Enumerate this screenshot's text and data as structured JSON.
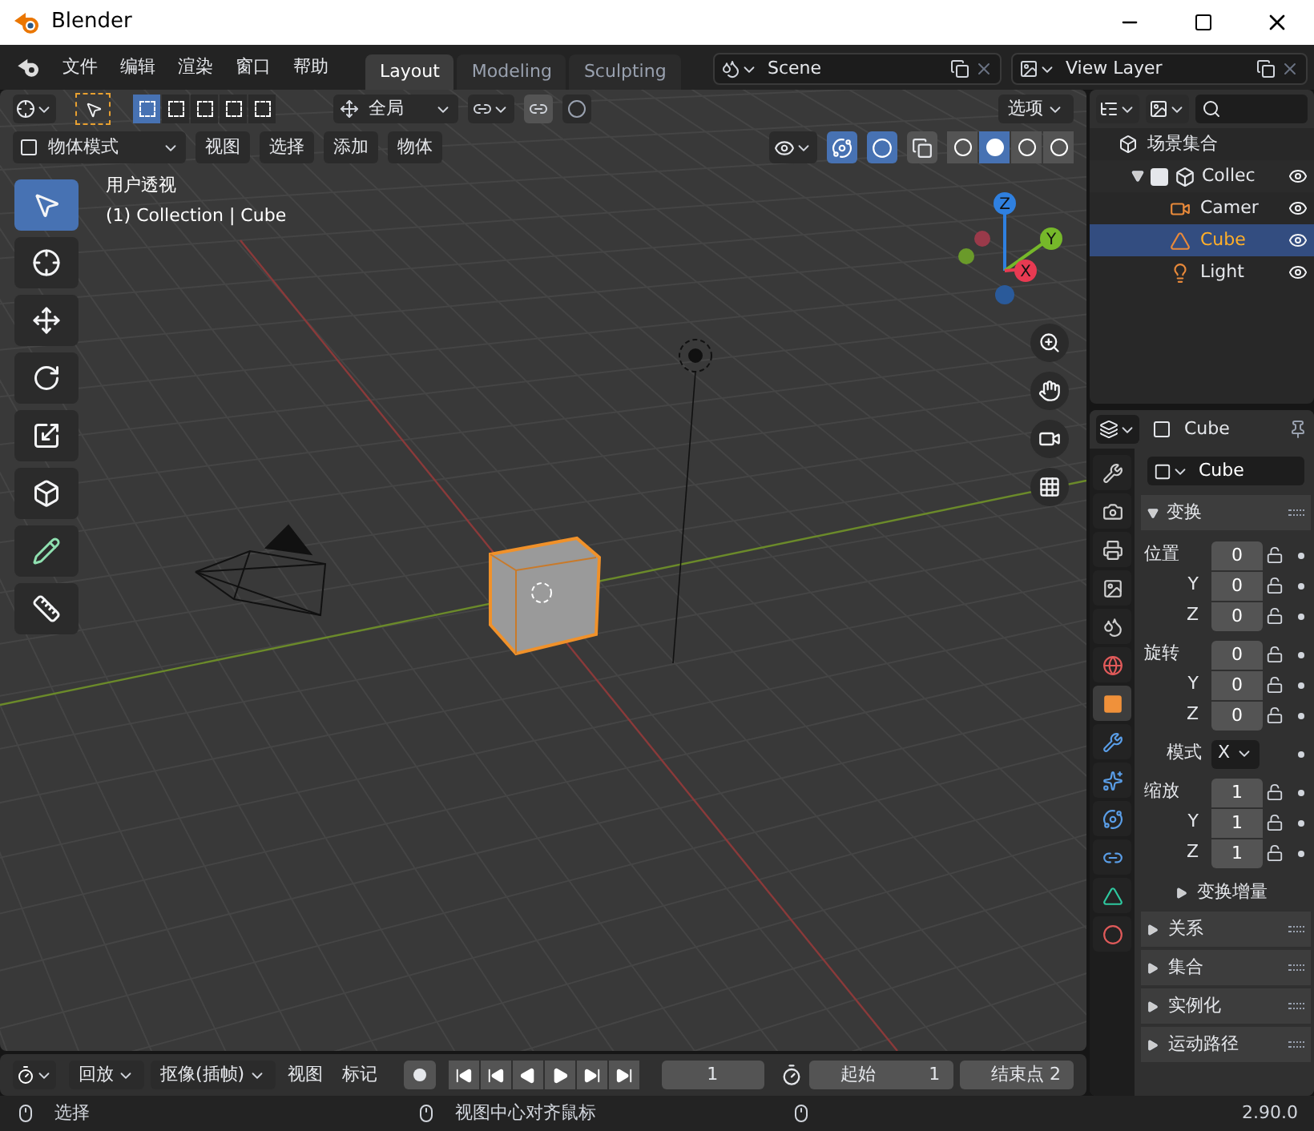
{
  "window": {
    "title": "Blender"
  },
  "menu": [
    "文件",
    "编辑",
    "渲染",
    "窗口",
    "帮助"
  ],
  "workspace_tabs": [
    {
      "label": "Layout",
      "selected": true
    },
    {
      "label": "Modeling",
      "selected": false
    },
    {
      "label": "Sculpting",
      "selected": false
    }
  ],
  "scene": {
    "value": "Scene"
  },
  "view_layer": {
    "value": "View Layer"
  },
  "viewport": {
    "select_modes": [
      {
        "selected": true
      },
      {
        "selected": false
      },
      {
        "selected": false
      },
      {
        "selected": false
      },
      {
        "selected": false
      }
    ],
    "orientation": "全局",
    "snap": {
      "on": false
    },
    "options": "选项",
    "mode": "物体模式",
    "menus": [
      "视图",
      "选择",
      "添加",
      "物体"
    ],
    "overlays": {
      "on": true
    },
    "xray": {
      "on": false
    },
    "gizmos": {
      "on": true
    },
    "shading": [
      {
        "selected": false
      },
      {
        "selected": true
      },
      {
        "selected": false
      },
      {
        "selected": false
      }
    ],
    "view_name": "用户透视",
    "object_info": "(1) Collection | Cube",
    "tools": [
      {
        "selected": true
      },
      {
        "selected": false
      },
      {
        "selected": false
      },
      {
        "selected": false
      },
      {
        "selected": false
      },
      {
        "selected": false
      },
      {
        "selected": false
      },
      {
        "selected": false
      }
    ],
    "gizmo_axes": [
      {
        "label": "Z",
        "color": "#2f80e0"
      },
      {
        "label": "Y",
        "color": "#76b82a"
      },
      {
        "label": "X",
        "color": "#e83a52"
      }
    ]
  },
  "outliner": {
    "root": "场景集合",
    "items": [
      {
        "label": "Collec",
        "checked": true,
        "expanded": true,
        "selected": false,
        "children": [
          {
            "kind": "camera",
            "label": "Camer",
            "selected": false
          },
          {
            "kind": "mesh",
            "label": "Cube",
            "selected": true
          },
          {
            "kind": "light",
            "label": "Light",
            "selected": false
          }
        ]
      }
    ]
  },
  "properties": {
    "object": "Cube",
    "name_field": "Cube",
    "tabs": [
      {
        "kind": "tool",
        "selected": false
      },
      {
        "kind": "render",
        "selected": false
      },
      {
        "kind": "output",
        "selected": false
      },
      {
        "kind": "view_layer",
        "selected": false
      },
      {
        "kind": "scene",
        "selected": false
      },
      {
        "kind": "world",
        "selected": false
      },
      {
        "kind": "object",
        "selected": true
      },
      {
        "kind": "modifier",
        "selected": false
      },
      {
        "kind": "particles",
        "selected": false
      },
      {
        "kind": "physics",
        "selected": false
      },
      {
        "kind": "constraint",
        "selected": false
      },
      {
        "kind": "mesh",
        "selected": false
      },
      {
        "kind": "material",
        "selected": false
      }
    ],
    "panel": {
      "title": "变换",
      "expanded": true
    },
    "groups": [
      {
        "rows": [
          {
            "label": "位置",
            "value": "0"
          },
          {
            "label": "Y",
            "value": "0"
          },
          {
            "label": "Z",
            "value": "0"
          }
        ]
      },
      {
        "rows": [
          {
            "label": "旋转",
            "value": "0"
          },
          {
            "label": "Y",
            "value": "0"
          },
          {
            "label": "Z",
            "value": "0"
          }
        ]
      },
      {
        "mode": {
          "label": "模式",
          "value": "X"
        }
      },
      {
        "rows": [
          {
            "label": "缩放",
            "value": "1"
          },
          {
            "label": "Y",
            "value": "1"
          },
          {
            "label": "Z",
            "value": "1"
          }
        ]
      }
    ],
    "subpanel": {
      "title": "变换增量",
      "expanded": false
    },
    "panels": [
      {
        "title": "关系",
        "expanded": false
      },
      {
        "title": "集合",
        "expanded": false
      },
      {
        "title": "实例化",
        "expanded": false
      },
      {
        "title": "运动路径",
        "expanded": false
      }
    ]
  },
  "timeline": {
    "playback": "回放",
    "keying": "抠像(插帧)",
    "menus": [
      "视图",
      "标记"
    ],
    "auto_key": {
      "on": false
    },
    "current_frame": "1",
    "start_label": "起始",
    "start": "1",
    "end_label": "结束点",
    "end": "2"
  },
  "status_bar": {
    "items": [
      "选择",
      "视图中心对齐鼠标"
    ],
    "version": "2.90.0"
  }
}
